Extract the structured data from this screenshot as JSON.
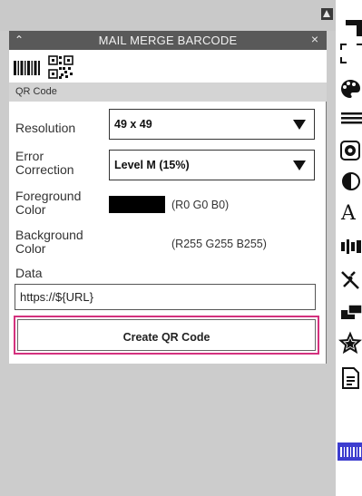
{
  "panel": {
    "title": "MAIL MERGE BARCODE",
    "tabs": [
      {
        "name": "barcode-tab",
        "icon": "barcode-icon"
      },
      {
        "name": "qr-tab",
        "icon": "qr-code-icon"
      }
    ],
    "active_tab_label": "QR Code",
    "fields": {
      "resolution": {
        "label": "Resolution",
        "value": "49 x 49"
      },
      "error_correction": {
        "label": "Error\nCorrection",
        "value": "Level M (15%)"
      },
      "foreground": {
        "label": "Foreground\nColor",
        "color": "#000000",
        "rgb_text": "(R0 G0 B0)"
      },
      "background": {
        "label": "Background\nColor",
        "color": "#ffffff",
        "rgb_text": "(R255 G255 B255)"
      },
      "data": {
        "label": "Data",
        "value": "https://${URL}"
      }
    },
    "create_button": "Create QR Code"
  },
  "toolbar": {
    "items": [
      "frame-icon",
      "crop-marks-icon",
      "palette-icon",
      "lines-icon",
      "pattern-icon",
      "contrast-icon",
      "text-icon",
      "align-icon",
      "magic-icon",
      "arrange-icon",
      "star-icon",
      "document-icon",
      "barcode-icon"
    ],
    "text_tool_glyph": "A"
  },
  "colors": {
    "accent": "#d4317e",
    "title_bar": "#595959",
    "active_tool": "#3d3dcf"
  }
}
